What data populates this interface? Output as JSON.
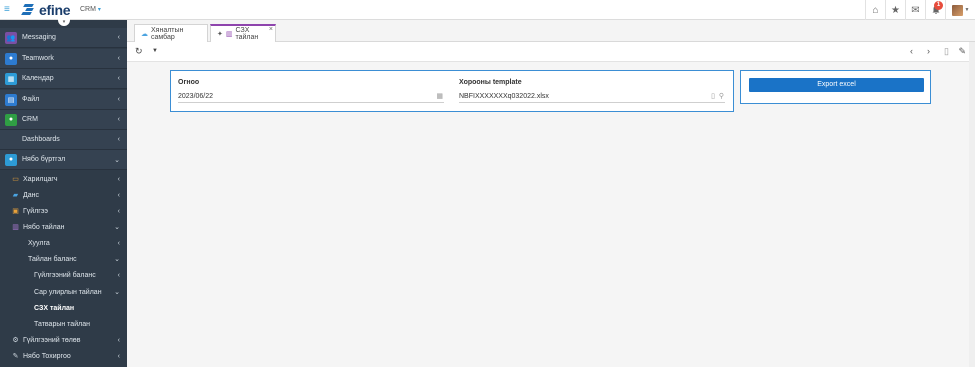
{
  "header": {
    "logo_text": "efine",
    "module_label": "CRM",
    "notification_count": "1",
    "icons": [
      "home-icon",
      "star-icon",
      "mail-icon",
      "bell-icon",
      "avatar"
    ]
  },
  "sidebar": {
    "top_items": [
      {
        "label": "Messaging",
        "color": "#7b4fa3",
        "icon": "users-icon"
      },
      {
        "label": "Teamwork",
        "color": "#2d7bd0",
        "icon": "user-icon"
      },
      {
        "label": "Календар",
        "color": "#2d9bd6",
        "icon": "calendar-icon"
      },
      {
        "label": "Файл",
        "color": "#2d7bd0",
        "icon": "file-icon"
      },
      {
        "label": "CRM",
        "color": "#2f9e44",
        "icon": "person-icon"
      },
      {
        "label": "Dashboards",
        "color": "#354251",
        "icon": ""
      },
      {
        "label": "Нябо бүртгэл",
        "color": "#2d9bd6",
        "icon": "person-icon"
      }
    ],
    "sub_items": [
      {
        "label": "Харилцагч"
      },
      {
        "label": "Данс"
      },
      {
        "label": "Гүйлгээ"
      },
      {
        "label": "Нябо тайлан"
      }
    ],
    "l3_items": [
      {
        "label": "Хуулга"
      },
      {
        "label": "Тайлан баланс"
      }
    ],
    "l4_items": [
      {
        "label": "Гүйлгээний баланс"
      },
      {
        "label": "Сар улирлын тайлан"
      },
      {
        "label": "СЗХ тайлан"
      },
      {
        "label": "Татварын тайлан"
      }
    ],
    "bottom_items": [
      {
        "label": "Гүйлгээний төлөв"
      },
      {
        "label": "Нябо Тохиргоо"
      }
    ]
  },
  "tabs": [
    {
      "label": "Хяналтын самбар"
    },
    {
      "label": "СЗХ тайлан"
    }
  ],
  "form": {
    "date_label": "Огноо",
    "date_value": "2023/06/22",
    "template_label": "Хорооны template",
    "template_value": "NBFIXXXXXXXq032022.xlsx"
  },
  "actions": {
    "export_label": "Export excel"
  },
  "colors": {
    "accent": "#1a73c7",
    "sidebar_bg": "#2f3b48",
    "active_tab": "#8e44ad",
    "panel_border": "#3b8ed4"
  }
}
